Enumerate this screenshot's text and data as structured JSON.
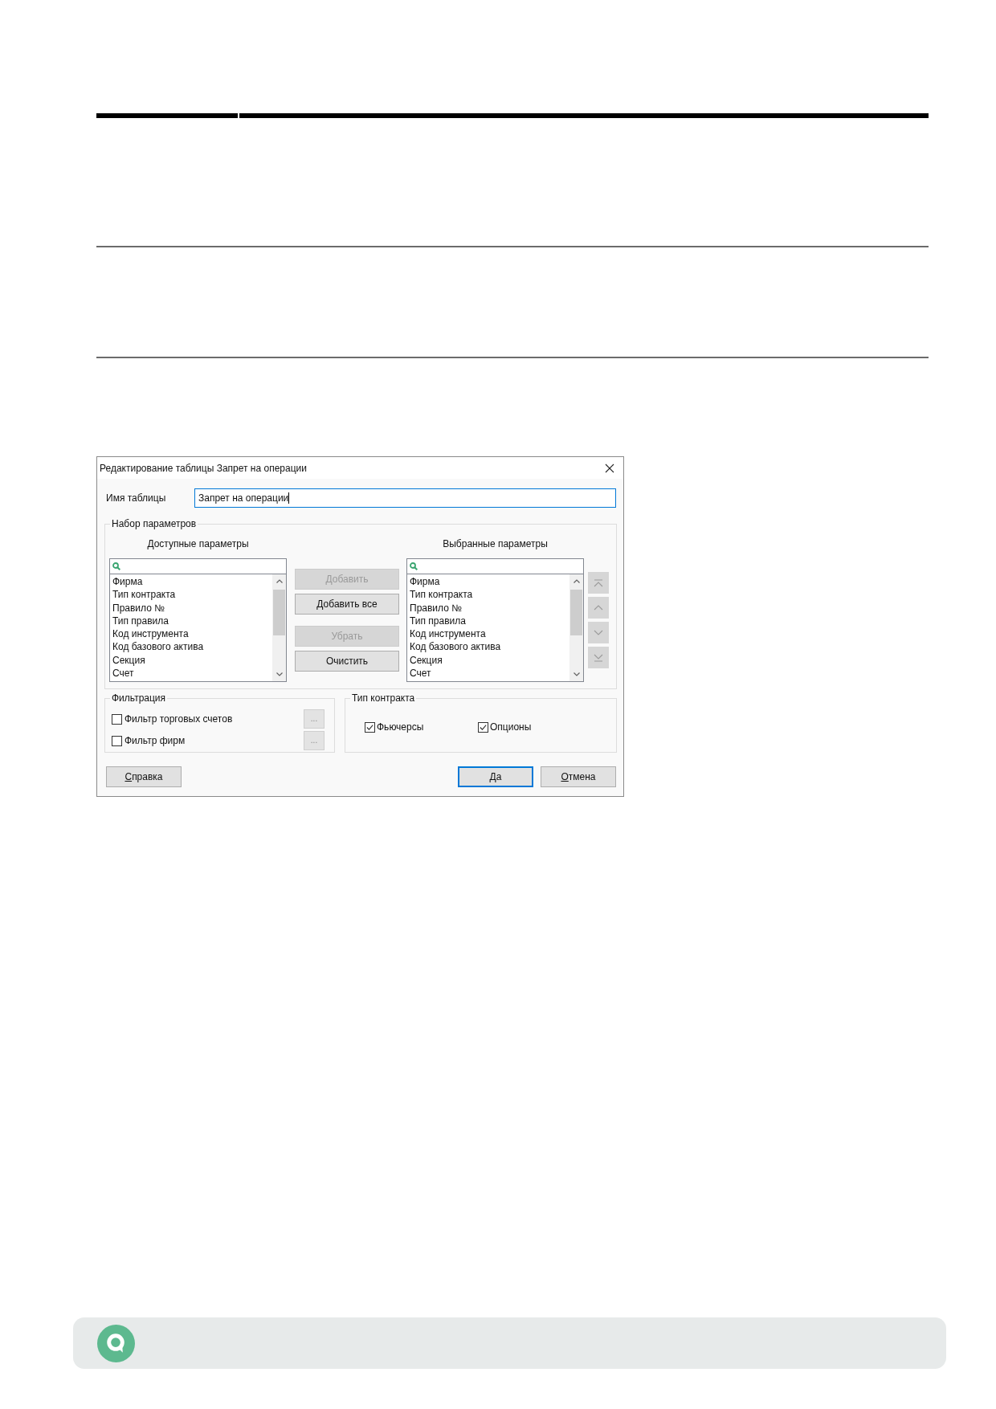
{
  "dialog": {
    "title": "Редактирование таблицы Запрет на операции",
    "table_name": {
      "label": "Имя таблицы",
      "value": "Запрет на операции",
      "focused": true
    },
    "parameter_set": {
      "title": "Набор параметров",
      "available": {
        "title": "Доступные параметры",
        "items": [
          "Фирма",
          "Тип контракта",
          "Правило №",
          "Тип правила",
          "Код инструмента",
          "Код базового актива",
          "Секция",
          "Счет"
        ]
      },
      "transfer_buttons": [
        {
          "label": "Добавить",
          "disabled": true
        },
        {
          "label": "Добавить все",
          "disabled": false
        },
        {
          "label": "Убрать",
          "disabled": true
        },
        {
          "label": "Очистить",
          "disabled": false
        }
      ],
      "selected": {
        "title": "Выбранные параметры",
        "items": [
          "Фирма",
          "Тип контракта",
          "Правило №",
          "Тип правила",
          "Код инструмента",
          "Код базового актива",
          "Секция",
          "Счет"
        ]
      },
      "order_buttons": [
        {
          "kind": "top",
          "disabled": true
        },
        {
          "kind": "up",
          "disabled": true
        },
        {
          "kind": "down",
          "disabled": true
        },
        {
          "kind": "bottom",
          "disabled": true
        }
      ]
    },
    "filtering": {
      "title": "Фильтрация",
      "filters": [
        {
          "label": "Фильтр торговых счетов",
          "checked": false,
          "browse": {
            "label": "...",
            "disabled": true
          }
        },
        {
          "label": "Фильтр фирм",
          "checked": false,
          "browse": {
            "label": "...",
            "disabled": true
          }
        }
      ]
    },
    "contract_type": {
      "title": "Тип контракта",
      "options": [
        {
          "label": "Фьючерсы",
          "checked": true
        },
        {
          "label": "Опционы",
          "checked": true
        }
      ]
    },
    "buttons": [
      {
        "label": "Справка",
        "default": false,
        "underlined_initial": true
      },
      {
        "label": "Да",
        "default": true,
        "underlined_initial": true
      },
      {
        "label": "Отмена",
        "default": false,
        "underlined_initial": true
      }
    ]
  }
}
